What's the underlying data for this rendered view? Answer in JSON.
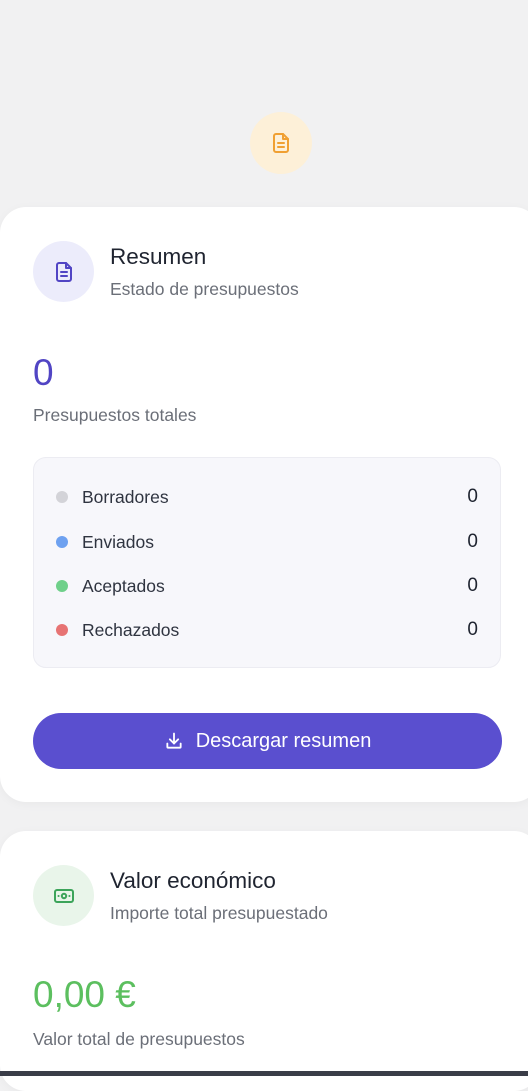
{
  "summary": {
    "title": "Resumen",
    "subtitle": "Estado de presupuestos",
    "total": "0",
    "total_label": "Presupuestos totales",
    "statuses": [
      {
        "label": "Borradores",
        "count": "0",
        "color": "#d3d3d8"
      },
      {
        "label": "Enviados",
        "count": "0",
        "color": "#6ea1f0"
      },
      {
        "label": "Aceptados",
        "count": "0",
        "color": "#6fd08a"
      },
      {
        "label": "Rechazados",
        "count": "0",
        "color": "#e77373"
      }
    ],
    "download_label": "Descargar resumen"
  },
  "value": {
    "title": "Valor económico",
    "subtitle": "Importe total presupuestado",
    "amount": "0,00 €",
    "amount_label": "Valor total de presupuestos"
  },
  "colors": {
    "primary": "#5a4fcf",
    "accent_orange": "#f0a032",
    "success_green": "#5cbf5f",
    "total_blue": "#5145c4"
  },
  "icons": {
    "top": "document-icon",
    "summary": "document-icon",
    "download": "download-icon",
    "value": "banknote-icon"
  }
}
